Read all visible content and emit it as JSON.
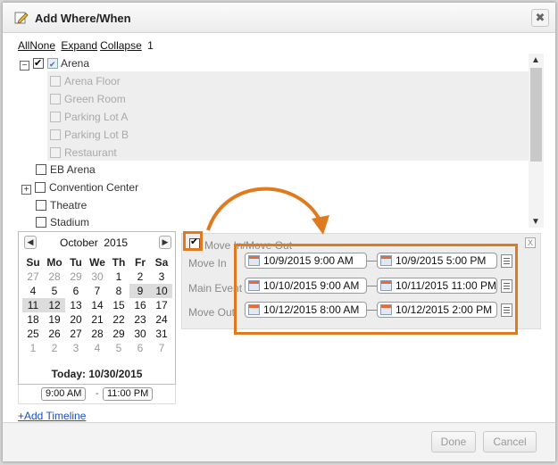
{
  "dialog": {
    "title": "Add Where/When",
    "close_label": "✖"
  },
  "tree_toolbar": {
    "all": "All",
    "none": "None",
    "expand": "Expand",
    "collapse": "Collapse",
    "count": "1"
  },
  "tree": {
    "arena": "Arena",
    "arena_floor": "Arena Floor",
    "green_room": "Green Room",
    "parking_lot_a": "Parking Lot A",
    "parking_lot_b": "Parking Lot B",
    "restaurant": "Restaurant",
    "eb_arena": "EB Arena",
    "convention_center": "Convention Center",
    "theatre": "Theatre",
    "stadium": "Stadium",
    "collapse_glyph": "−",
    "expand_glyph": "+"
  },
  "calendar": {
    "month": "October",
    "year": "2015",
    "prev": "◀",
    "next": "▶",
    "weekdays": [
      "Su",
      "Mo",
      "Tu",
      "We",
      "Th",
      "Fr",
      "Sa"
    ],
    "weeks": [
      [
        "27",
        "28",
        "29",
        "30",
        "1",
        "2",
        "3"
      ],
      [
        "4",
        "5",
        "6",
        "7",
        "8",
        "9",
        "10"
      ],
      [
        "11",
        "12",
        "13",
        "14",
        "15",
        "16",
        "17"
      ],
      [
        "18",
        "19",
        "20",
        "21",
        "22",
        "23",
        "24"
      ],
      [
        "25",
        "26",
        "27",
        "28",
        "29",
        "30",
        "31"
      ],
      [
        "1",
        "2",
        "3",
        "4",
        "5",
        "6",
        "7"
      ]
    ],
    "today_label": "Today: 10/30/2015"
  },
  "time_range": {
    "start": "9:00 AM",
    "end": "11:00 PM",
    "dash": "-"
  },
  "add_timeline": "+Add Timeline",
  "timeline_panel": {
    "title": "Move In/Move Out",
    "close": "X",
    "rows": [
      {
        "label": "Move In",
        "start": "10/9/2015  9:00 AM",
        "end": "10/9/2015  5:00 PM"
      },
      {
        "label": "Main Event",
        "start": "10/10/2015  9:00 AM",
        "end": "10/11/2015 11:00 PM"
      },
      {
        "label": "Move Out",
        "start": "10/12/2015  8:00 AM",
        "end": "10/12/2015  2:00 PM"
      }
    ]
  },
  "footer": {
    "done": "Done",
    "cancel": "Cancel"
  },
  "colors": {
    "highlight": "#e07a1f",
    "link": "#1a4fc4"
  }
}
